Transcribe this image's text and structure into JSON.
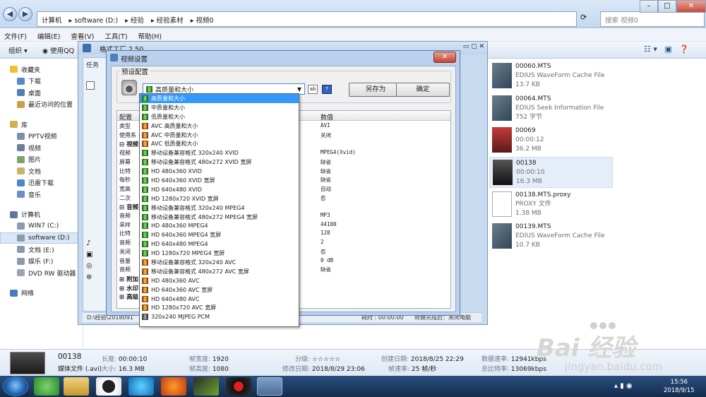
{
  "explorer": {
    "breadcrumb": [
      "计算机",
      "software (D:)",
      "经验",
      "经验素材",
      "视频0"
    ],
    "search_placeholder": "搜索 视频0",
    "menus": [
      "文件(F)",
      "编辑(E)",
      "查看(V)",
      "工具(T)",
      "帮助(H)"
    ],
    "organize": "组织 ▾",
    "use_qq": "使用QQ"
  },
  "nav": {
    "favorites": "收藏夹",
    "fav_items": [
      "下载",
      "桌面",
      "最近访问的位置"
    ],
    "library": "库",
    "lib_items": [
      "PPTV视频",
      "视频",
      "图片",
      "文档",
      "迅雷下载",
      "音乐"
    ],
    "computer": "计算机",
    "drives": [
      "WIN7 (C:)",
      "software (D:)",
      "文档 (E:)",
      "娱乐 (F:)",
      "DVD RW 驱动器 ("
    ],
    "network": "网络"
  },
  "files": [
    {
      "name": "00060.MTS",
      "type": "EDIUS WaveForm Cache File",
      "size": "13.7 KB"
    },
    {
      "name": "00064.MTS",
      "type": "EDIUS Seek Information File",
      "size": "752 字节"
    },
    {
      "name": "00069",
      "type": "00:00:12",
      "size": "36.2 MB"
    },
    {
      "name": "00138",
      "type": "00:00:10",
      "size": "16.3 MB"
    },
    {
      "name": "00138.MTS.proxy",
      "type": "PROXY 文件",
      "size": "1.38 MB"
    },
    {
      "name": "00139.MTS",
      "type": "EDIUS WaveForm Cache File",
      "size": "10.7 KB"
    }
  ],
  "ff": {
    "title": "格式工厂 2.50",
    "tab": "任务",
    "status_left": "D:\\经验\\2018091",
    "status_mid": "耗时 : 00:00:00",
    "status_right": "转换完成后：关闭电脑"
  },
  "dialog": {
    "title": "视频设置",
    "preset_legend": "预设配置",
    "selected_preset": "高质量和大小",
    "save_as": "另存为",
    "ok": "确定",
    "col_config": "配置",
    "col_value": "数值"
  },
  "grid_rows": [
    {
      "label": "类型",
      "value": "AVI",
      "group": false
    },
    {
      "label": "使用系",
      "value": "关闭",
      "group": false
    },
    {
      "label": "⊟ 视频",
      "value": "",
      "group": true
    },
    {
      "label": "视频",
      "value": "MPEG4(Xvid)",
      "group": false
    },
    {
      "label": "屏幕",
      "value": "缺省",
      "group": false
    },
    {
      "label": "比特",
      "value": "缺省",
      "group": false
    },
    {
      "label": "每秒",
      "value": "缺省",
      "group": false
    },
    {
      "label": "宽高",
      "value": "自动",
      "group": false
    },
    {
      "label": "二次",
      "value": "否",
      "group": false
    },
    {
      "label": "⊟ 音频",
      "value": "",
      "group": true
    },
    {
      "label": "音频",
      "value": "MP3",
      "group": false
    },
    {
      "label": "采样",
      "value": "44100",
      "group": false
    },
    {
      "label": "比特",
      "value": "128",
      "group": false
    },
    {
      "label": "音频",
      "value": "2",
      "group": false
    },
    {
      "label": "关闭",
      "value": "否",
      "group": false
    },
    {
      "label": "音量",
      "value": "0 dB",
      "group": false
    },
    {
      "label": "音频",
      "value": "缺省",
      "group": false
    },
    {
      "label": "⊞ 附加",
      "value": "",
      "group": true
    },
    {
      "label": "⊞ 水印",
      "value": "",
      "group": true
    },
    {
      "label": "⊞ 高级",
      "value": "",
      "group": true
    }
  ],
  "dropdown_items": [
    {
      "label": "高质量和大小",
      "icon": "green"
    },
    {
      "label": "中质量和大小",
      "icon": "green"
    },
    {
      "label": "低质量和大小",
      "icon": "green"
    },
    {
      "label": "AVC 高质量和大小",
      "icon": "orange"
    },
    {
      "label": "AVC 中质量和大小",
      "icon": "orange"
    },
    {
      "label": "AVC 低质量和大小",
      "icon": "orange"
    },
    {
      "label": "移动设备兼容格式 320x240 XVID",
      "icon": "green"
    },
    {
      "label": "移动设备兼容格式 480x272 XVID 宽屏",
      "icon": "green"
    },
    {
      "label": "HD 480x360 XVID",
      "icon": "green"
    },
    {
      "label": "HD 640x360 XVID 宽屏",
      "icon": "green"
    },
    {
      "label": "HD 640x480 XVID",
      "icon": "green"
    },
    {
      "label": "HD 1280x720 XVID 宽屏",
      "icon": "green"
    },
    {
      "label": "移动设备兼容格式 320x240 MPEG4",
      "icon": "green"
    },
    {
      "label": "移动设备兼容格式 480x272 MPEG4 宽屏",
      "icon": "green"
    },
    {
      "label": "HD 480x360 MPEG4",
      "icon": "green"
    },
    {
      "label": "HD 640x360 MPEG4 宽屏",
      "icon": "green"
    },
    {
      "label": "HD 640x480 MPEG4",
      "icon": "green"
    },
    {
      "label": "HD 1280x720 MPEG4 宽屏",
      "icon": "green"
    },
    {
      "label": "移动设备兼容格式 320x240 AVC",
      "icon": "orange"
    },
    {
      "label": "移动设备兼容格式 480x272 AVC 宽屏",
      "icon": "orange"
    },
    {
      "label": "HD 480x360 AVC",
      "icon": "orange"
    },
    {
      "label": "HD 640x360 AVC 宽屏",
      "icon": "orange"
    },
    {
      "label": "HD 640x480 AVC",
      "icon": "orange"
    },
    {
      "label": "HD 1280x720 AVC 宽屏",
      "icon": "orange"
    },
    {
      "label": "320x240 MJPEG PCM",
      "icon": "grey"
    }
  ],
  "details": {
    "name": "00138",
    "kind": "媒体文件 (.avi)",
    "len_k": "长度:",
    "len_v": "00:00:10",
    "size_k": "大小:",
    "size_v": "16.3 MB",
    "fw_k": "帧宽度:",
    "fw_v": "1920",
    "fh_k": "帧高度:",
    "fh_v": "1080",
    "rating_k": "分级:",
    "rating_v": "☆☆☆☆☆",
    "mod_k": "修改日期:",
    "mod_v": "2018/8/29 23:06",
    "created_k": "创建日期:",
    "created_v": "2018/8/25 22:29",
    "rate_k": "帧速率:",
    "rate_v": "25 帧/秒",
    "drate_k": "数据速率:",
    "drate_v": "12941kbps",
    "total_k": "总比特率:",
    "total_v": "13069kbps"
  },
  "clock": {
    "time": "15:56",
    "date": "2018/9/15"
  },
  "watermark": {
    "brand": "Bai  经验",
    "url": "jingyan.baidu.com"
  }
}
